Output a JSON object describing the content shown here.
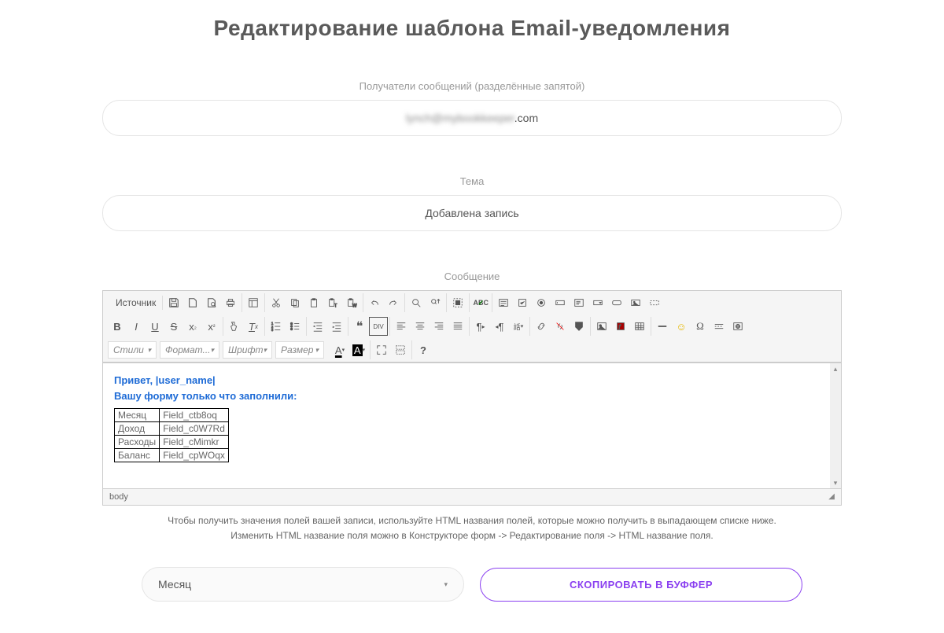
{
  "page": {
    "title": "Редактирование шаблона Email-уведомления"
  },
  "recipients": {
    "label": "Получатели сообщений (разделённые запятой)",
    "value_prefix": "lynch@mybookkeeper",
    "value_suffix": ".com"
  },
  "subject": {
    "label": "Тема",
    "value": "Добавлена запись"
  },
  "message": {
    "label": "Сообщение"
  },
  "toolbar": {
    "source": "Источник",
    "combos": {
      "styles": "Стили",
      "format": "Формат...",
      "font": "Шрифт",
      "size": "Размер"
    }
  },
  "editor": {
    "greeting": "Привет, |user_name|",
    "line2": "Вашу форму только что заполнили:",
    "table": [
      {
        "label": "Месяц",
        "field": "Field_ctb8oq"
      },
      {
        "label": "Доход",
        "field": "Field_c0W7Rd"
      },
      {
        "label": "Расходы",
        "field": "Field_cMimkr"
      },
      {
        "label": "Баланс",
        "field": "Field_cpWOqx"
      }
    ],
    "status_path": "body"
  },
  "help": {
    "line1": "Чтобы получить значения полей вашей записи, используйте HTML названия полей, которые можно получить в выпадающем списке ниже.",
    "line2": "Изменить HTML название поля можно в Конструкторе форм -> Редактирование поля -> HTML название поля."
  },
  "bottom": {
    "select_value": "Месяц",
    "copy_button": "СКОПИРОВАТЬ В БУФФЕР"
  }
}
